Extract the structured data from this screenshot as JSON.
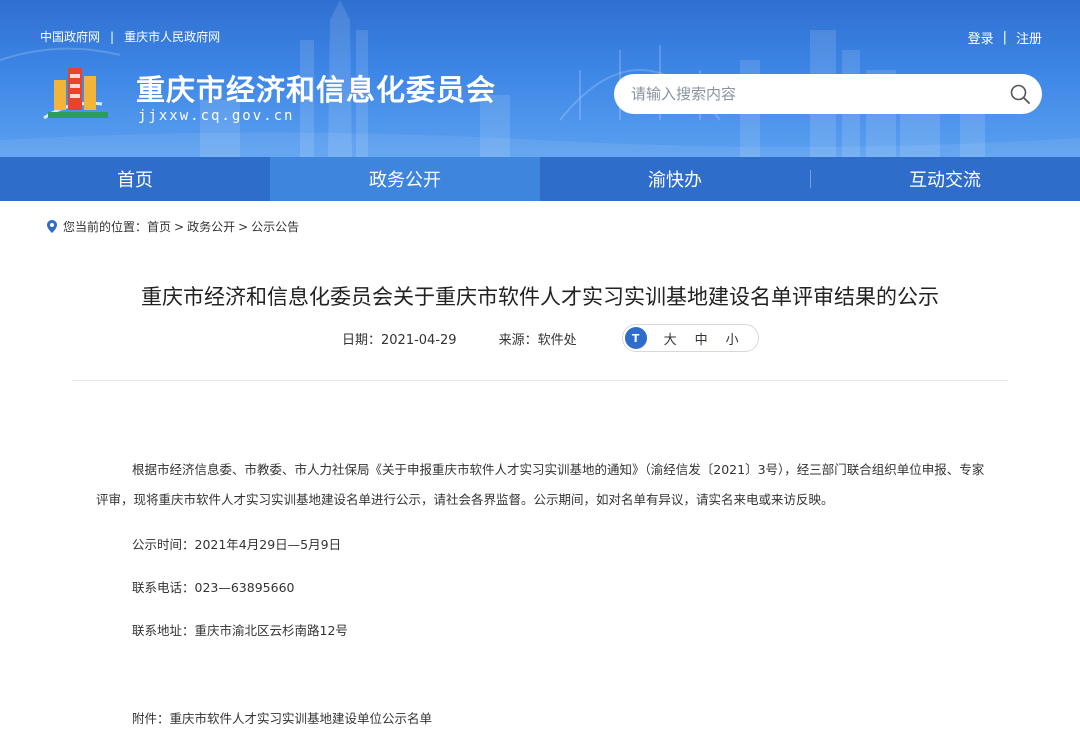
{
  "header": {
    "top_links": [
      "中国政府网",
      "重庆市人民政府网"
    ],
    "link_separator": "|",
    "auth": {
      "login": "登录",
      "register": "注册"
    },
    "site_title": "重庆市经济和信息化委员会",
    "site_domain": "jjxxw.cq.gov.cn",
    "search": {
      "placeholder": "请输入搜索内容",
      "value": ""
    },
    "colors": {
      "primary": "#2e6dc9",
      "nav_active": "#3e86dd"
    }
  },
  "nav": {
    "items": [
      {
        "label": "首页"
      },
      {
        "label": "政务公开"
      },
      {
        "label": "渝快办"
      },
      {
        "label": "互动交流"
      }
    ]
  },
  "breadcrumb": {
    "prefix": "您当前的位置：",
    "items": [
      "首页",
      "政务公开",
      "公示公告"
    ],
    "arrow": ">"
  },
  "article": {
    "title": "重庆市经济和信息化委员会关于重庆市软件人才实习实训基地建设名单评审结果的公示",
    "date": "日期：2021-04-29",
    "source": "来源：软件处",
    "font_sizes": {
      "icon": "T",
      "large": "大",
      "medium": "中",
      "small": "小"
    },
    "paragraph": "根据市经济信息委、市教委、市人力社保局《关于申报重庆市软件人才实习实训基地的通知》（渝经信发〔2021〕3号），经三部门联合组织单位申报、专家评审，现将重庆市软件人才实习实训基地建设名单进行公示，请社会各界监督。公示期间，如对名单有异议，请实名来电或来访反映。",
    "period": "公示时间：2021年4月29日—5月9日",
    "phone": "联系电话：023—63895660",
    "address": "联系地址：重庆市渝北区云杉南路12号",
    "attachment": "附件：重庆市软件人才实习实训基地建设单位公示名单"
  }
}
